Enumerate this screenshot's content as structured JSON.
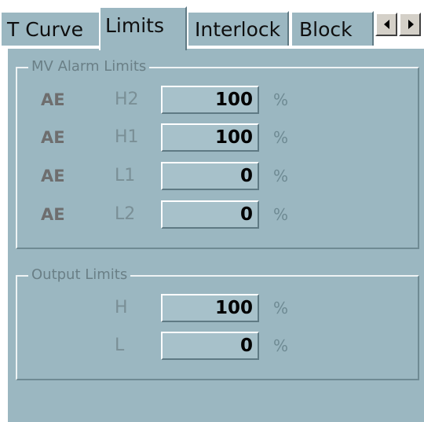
{
  "tabs": [
    {
      "label": "T Curve"
    },
    {
      "label": "Limits"
    },
    {
      "label": "Interlock"
    },
    {
      "label": "Block"
    }
  ],
  "scroll": {
    "left_icon": "arrow-left-icon",
    "right_icon": "arrow-right-icon"
  },
  "mv_alarm": {
    "title": "MV Alarm Limits",
    "rows": [
      {
        "flag": "AE",
        "limit": "H2",
        "value": "100",
        "unit": "%"
      },
      {
        "flag": "AE",
        "limit": "H1",
        "value": "100",
        "unit": "%"
      },
      {
        "flag": "AE",
        "limit": "L1",
        "value": "0",
        "unit": "%"
      },
      {
        "flag": "AE",
        "limit": "L2",
        "value": "0",
        "unit": "%"
      }
    ]
  },
  "output": {
    "title": "Output Limits",
    "rows": [
      {
        "limit": "H",
        "value": "100",
        "unit": "%"
      },
      {
        "limit": "L",
        "value": "0",
        "unit": "%"
      }
    ]
  },
  "colors": {
    "panel": "#9bb7c1",
    "field": "#a7c1ca"
  }
}
